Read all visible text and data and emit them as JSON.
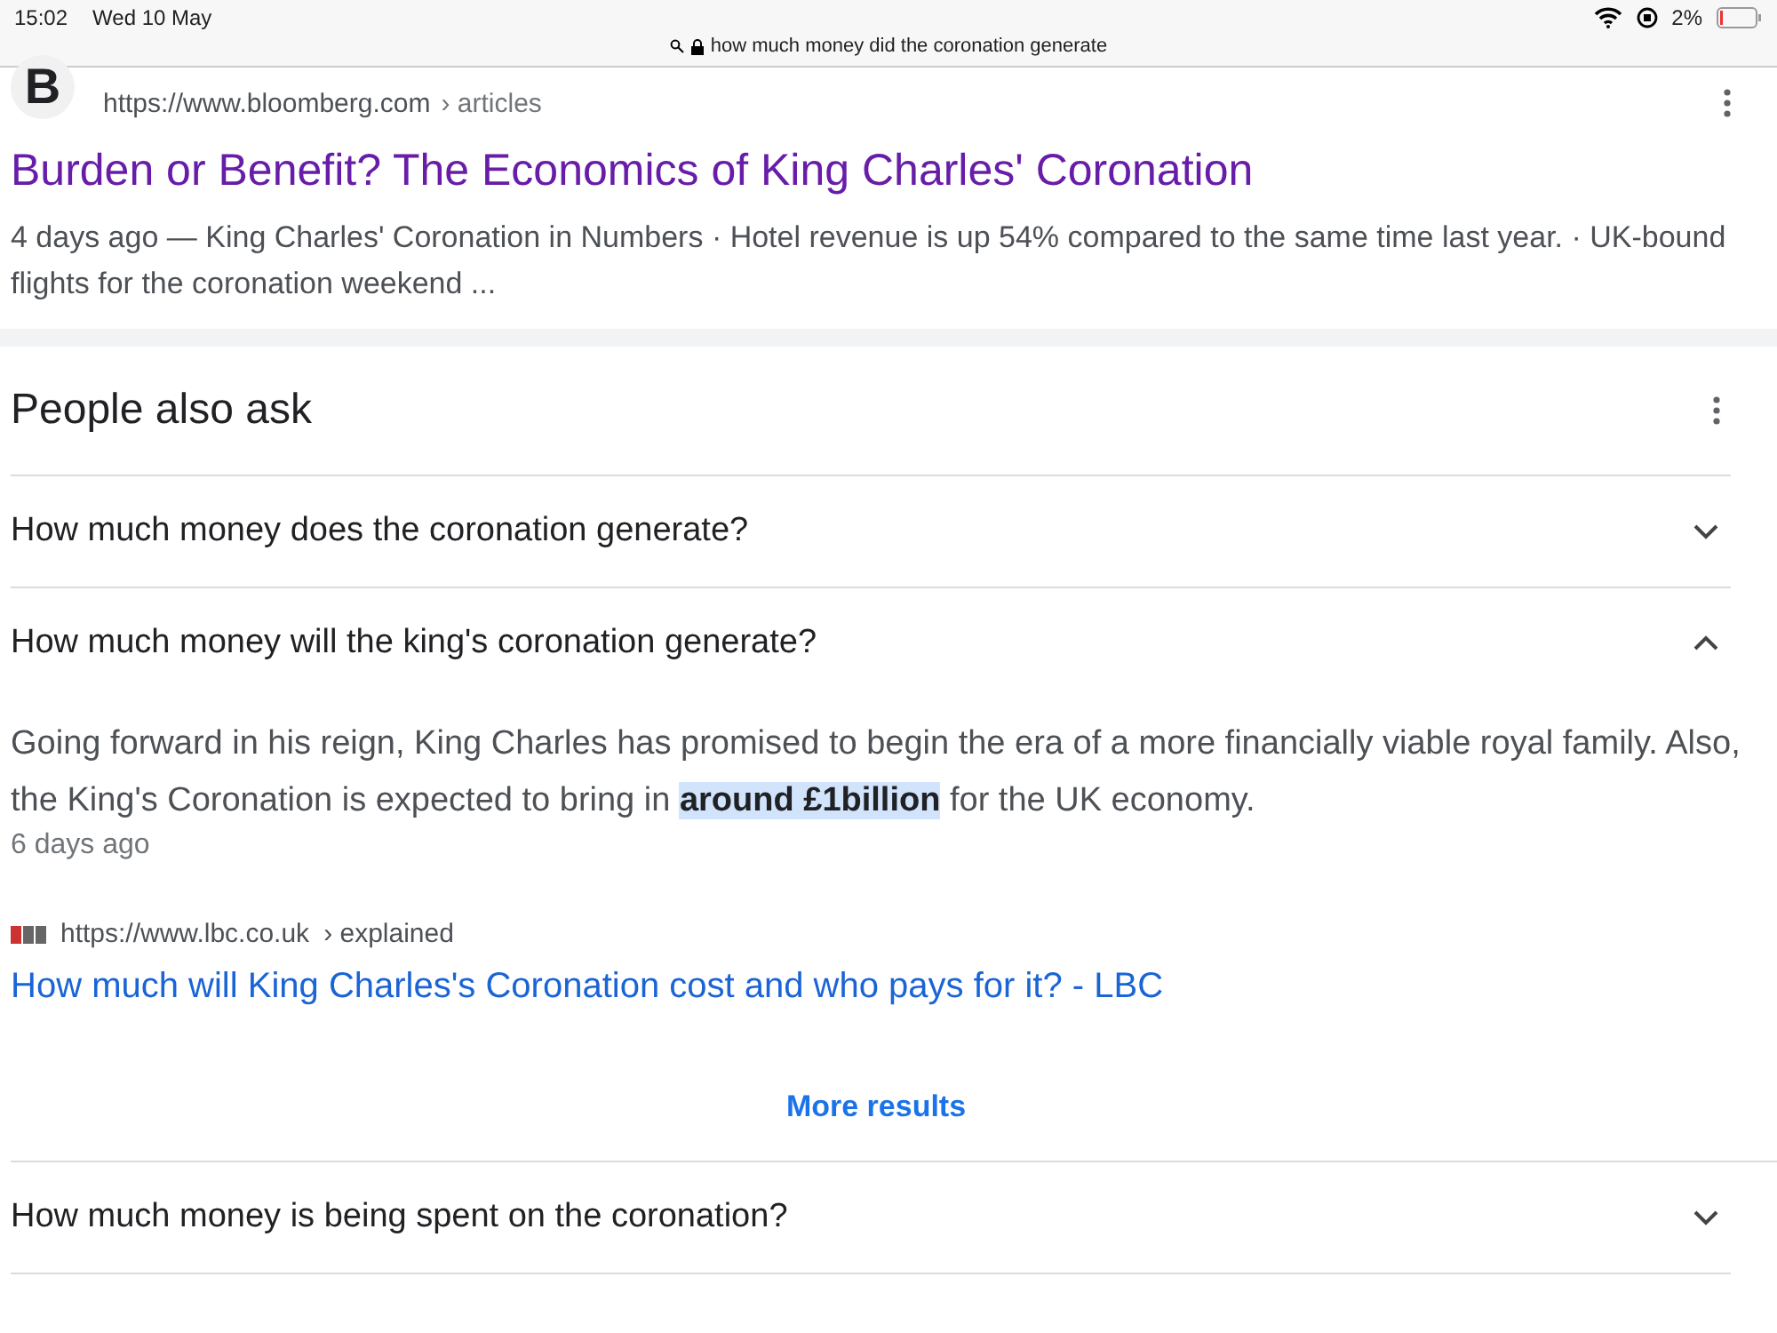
{
  "status_bar": {
    "time": "15:02",
    "date": "Wed 10 May",
    "battery": "2%",
    "address": "how much money did the coronation generate"
  },
  "result": {
    "logo_letter": "B",
    "url": "https://www.bloomberg.com",
    "path": "› articles",
    "title": "Burden or Benefit? The Economics of King Charles' Coronation",
    "snippet": "4 days ago — King Charles' Coronation in Numbers · Hotel revenue is up 54% compared to the same time last year. · UK-bound flights for the coronation weekend ..."
  },
  "people_also_ask": {
    "heading": "People also ask",
    "questions": [
      {
        "text": "How much money does the coronation generate?",
        "expanded": false
      },
      {
        "text": "How much money will the king's coronation generate?",
        "expanded": true,
        "answer": "Going forward in his reign, King Charles has promised to begin the era of a more financially viable royal family. Also, the King's Coronation is expected to bring in **around £1billion** for the UK economy.",
        "date": "6 days ago",
        "source_url": "https://www.lbc.co.uk",
        "source_path": "› explained",
        "link": "How much will King Charles's Coronation cost and who pays for it? - LBC",
        "more": "More results"
      },
      {
        "text": "How much money is being spent on the coronation?",
        "expanded": false
      }
    ]
  }
}
